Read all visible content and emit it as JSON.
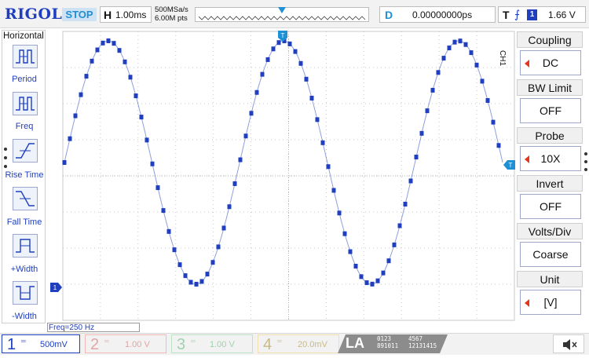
{
  "brand": "RIGOL",
  "status": "STOP",
  "horizontal": {
    "key": "H",
    "timebase": "1.00ms",
    "sample_rate": "500MSa/s",
    "memory": "6.00M pts"
  },
  "delay": {
    "key": "D",
    "value": "0.00000000ps"
  },
  "trigger": {
    "key": "T",
    "edge_icon": "rising-edge-icon",
    "source": "1",
    "level": "1.66 V"
  },
  "left_menu": {
    "title": "Horizontal",
    "items": [
      {
        "label": "Period",
        "icon": "period-icon"
      },
      {
        "label": "Freq",
        "icon": "freq-icon"
      },
      {
        "label": "Rise Time",
        "icon": "rise-time-icon"
      },
      {
        "label": "Fall Time",
        "icon": "fall-time-icon"
      },
      {
        "label": "+Width",
        "icon": "pos-width-icon"
      },
      {
        "label": "-Width",
        "icon": "neg-width-icon"
      }
    ]
  },
  "channel_menu": {
    "channel": "CH1",
    "items": [
      {
        "title": "Coupling",
        "value": "DC",
        "has_arrow": true
      },
      {
        "title": "BW Limit",
        "value": "OFF",
        "has_arrow": false
      },
      {
        "title": "Probe",
        "value": "10X",
        "has_arrow": true
      },
      {
        "title": "Invert",
        "value": "OFF",
        "has_arrow": false
      },
      {
        "title": "Volts/Div",
        "value": "Coarse",
        "has_arrow": false
      },
      {
        "title": "Unit",
        "value": "[V]",
        "has_arrow": true
      }
    ]
  },
  "measurement": "Freq=250 Hz",
  "markers": {
    "trigger_position": "T",
    "trigger_level": "T",
    "channel_ground": "1"
  },
  "channels": [
    {
      "num": "1",
      "coupling": "═",
      "scale": "500mV",
      "active": true,
      "color": "#1f3fbf"
    },
    {
      "num": "2",
      "coupling": "═",
      "scale": "1.00 V",
      "active": false,
      "color": "#e2a5a5"
    },
    {
      "num": "3",
      "coupling": "═",
      "scale": "1.00 V",
      "active": false,
      "color": "#9fd3ac"
    },
    {
      "num": "4",
      "coupling": "═",
      "scale": "20.0mV",
      "active": false,
      "color": "#c8b98a"
    }
  ],
  "logic_analyzer": {
    "label": "LA",
    "bits_low": "0123\n891011",
    "bits_high": "4567\n12131415"
  },
  "speaker_icon": "speaker-mute-icon",
  "waveform": {
    "type": "sine",
    "periods_on_screen": 2.5,
    "color": "#1f3fbf"
  }
}
